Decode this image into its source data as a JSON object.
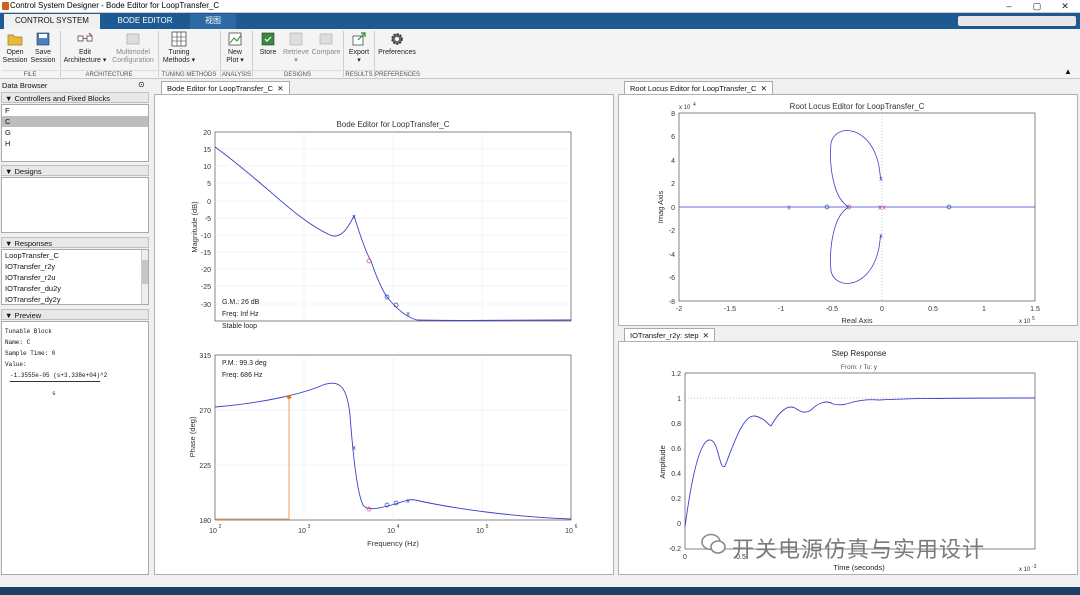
{
  "window": {
    "title": "Control System Designer - Bode Editor for LoopTransfer_C",
    "min": "–",
    "max": "▢",
    "close": "✕"
  },
  "tabs": [
    "CONTROL SYSTEM",
    "BODE EDITOR",
    "视图"
  ],
  "ribbon": {
    "buttons": [
      {
        "l1": "Open",
        "l2": "Session"
      },
      {
        "l1": "Save",
        "l2": "Session"
      },
      {
        "l1": "Edit",
        "l2": "Architecture ▾"
      },
      {
        "l1": "Multimodel",
        "l2": "Configuration"
      },
      {
        "l1": "Tuning",
        "l2": "Methods ▾"
      },
      {
        "l1": "New",
        "l2": "Plot ▾"
      },
      {
        "l1": "Store",
        "l2": ""
      },
      {
        "l1": "Retrieve",
        "l2": "▾"
      },
      {
        "l1": "Compare",
        "l2": ""
      },
      {
        "l1": "Export",
        "l2": "▾"
      },
      {
        "l1": "Preferences",
        "l2": ""
      }
    ],
    "groups": [
      "FILE",
      "ARCHITECTURE",
      "TUNING METHODS",
      "ANALYSIS",
      "DESIGNS",
      "RESULTS",
      "PREFERENCES"
    ]
  },
  "browser": {
    "title": "Data Browser",
    "controllers_header": "Controllers and Fixed Blocks",
    "controllers": [
      "F",
      "C",
      "G",
      "H"
    ],
    "designs_header": "Designs",
    "responses_header": "Responses",
    "responses": [
      "LoopTransfer_C",
      "IOTransfer_r2y",
      "IOTransfer_r2u",
      "IOTransfer_du2y",
      "IOTransfer_dy2y"
    ],
    "preview_header": "Preview",
    "preview": {
      "l1": "Tunable Block",
      "l2": "Name: C",
      "l3": "Sample Time: 0",
      "l4": "Value:",
      "num": "-1.3555e-05 (s+3.338e+04)^2",
      "den": "s"
    }
  },
  "bode": {
    "tab": "Bode Editor for LoopTransfer_C",
    "title": "Bode Editor for LoopTransfer_C",
    "mag_ylabel": "Magnitude (dB)",
    "phase_ylabel": "Phase (deg)",
    "xlabel": "Frequency (Hz)",
    "gm": "G.M.: 26 dB",
    "gm_freq": "Freq: Inf Hz",
    "stable": "Stable loop",
    "pm": "P.M.: 99.3 deg",
    "pm_freq": "Freq: 686 Hz",
    "mag_ticks": [
      "20",
      "15",
      "10",
      "5",
      "0",
      "-5",
      "-10",
      "-15",
      "-20",
      "-25",
      "-30"
    ],
    "phase_ticks": [
      "315",
      "270",
      "225",
      "180"
    ],
    "x_ticks": [
      "10",
      "10",
      "10",
      "10",
      "10"
    ],
    "x_exp": [
      "2",
      "3",
      "4",
      "5",
      "6"
    ]
  },
  "rlocus": {
    "tab": "Root Locus Editor for LoopTransfer_C",
    "title": "Root Locus Editor for LoopTransfer_C",
    "xlabel": "Real Axis",
    "ylabel": "Imag Axis",
    "y_scale": "x 10",
    "y_scale_exp": "4",
    "x_scale": "x 10",
    "x_scale_exp": "5",
    "x_ticks": [
      "-2",
      "-1.5",
      "-1",
      "-0.5",
      "0",
      "0.5",
      "1",
      "1.5"
    ],
    "y_ticks": [
      "8",
      "6",
      "4",
      "2",
      "0",
      "-2",
      "-4",
      "-6",
      "-8"
    ]
  },
  "step": {
    "tab": "IOTransfer_r2y: step",
    "title": "Step Response",
    "subtitle": "From: r  To: y",
    "xlabel": "Time (seconds)",
    "ylabel": "Amplitude",
    "x_scale": "x 10",
    "x_scale_exp": "-3",
    "y_ticks": [
      "1.2",
      "1",
      "0.8",
      "0.6",
      "0.4",
      "0.2",
      "0",
      "-0.2"
    ],
    "x_ticks": [
      "0",
      "0.5"
    ]
  },
  "watermark": "开关电源仿真与实用设计"
}
